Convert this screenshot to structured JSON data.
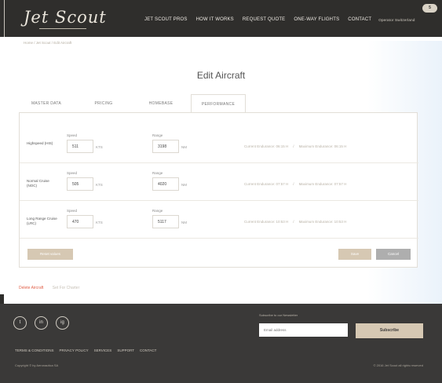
{
  "header": {
    "logo": "Jet Scout",
    "nav": [
      "JET SCOUT PROS",
      "HOW IT WORKS",
      "REQUEST QUOTE",
      "ONE-WAY FLIGHTS",
      "CONTACT"
    ],
    "operator": "Operator Switzerland",
    "badge": "5"
  },
  "breadcrumb": "Home / Jet Scout / Edit Aircraft",
  "page_title": "Edit Aircraft",
  "tabs": [
    "MASTER DATA",
    "PRICING",
    "HOMEBASE",
    "PERFORMANCE"
  ],
  "active_tab": "PERFORMANCE",
  "performance": {
    "speed_label": "Speed",
    "range_label": "Range",
    "speed_unit": "KTS",
    "range_unit": "NM",
    "rows": [
      {
        "name": "Highspeed (HIS)",
        "speed": "511",
        "range": "3198",
        "current": "Current Endurance: 06:15 H",
        "max": "Maximum Endurance: 06:15 H"
      },
      {
        "name": "Normal Cruise (NOC)",
        "speed": "505",
        "range": "4020",
        "current": "Current Endurance: 07:57 H",
        "max": "Maximum Endurance: 07:57 H"
      },
      {
        "name": "Long Range Cruise (LRC)",
        "speed": "470",
        "range": "5117",
        "current": "Current Endurance: 10:53 H",
        "max": "Maximum Endurance: 10:53 H"
      }
    ],
    "separator": "/"
  },
  "buttons": {
    "reset": "Reset values",
    "save": "Save",
    "cancel": "Cancel"
  },
  "links": {
    "delete": "Delete Aircraft",
    "other": "Set For Charter"
  },
  "footer": {
    "social": [
      "t",
      "in",
      "ig"
    ],
    "newsletter": "Subscribe to our Newsletter",
    "email_placeholder": "Email address",
    "subscribe": "Subscribe",
    "links": [
      "TERMS & CONDITIONS",
      "PRIVACY POLICY",
      "SERVICES",
      "SUPPORT",
      "CONTACT"
    ],
    "copyright_left": "Copyright © by Aeronautica SA",
    "copyright_right": "© 2016 Jet Scout all rights reserved"
  }
}
